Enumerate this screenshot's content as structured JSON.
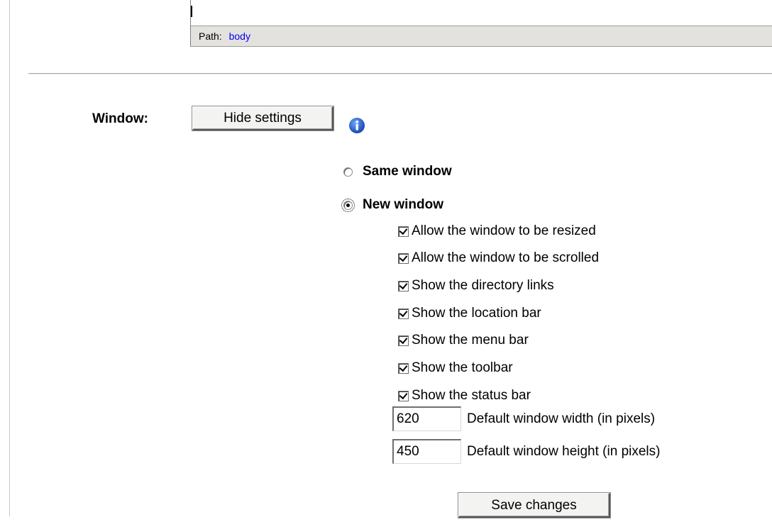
{
  "editor": {
    "path_label": "Path:",
    "path_value": "body"
  },
  "window_settings": {
    "label": "Window:",
    "hide_button": "Hide settings",
    "info_icon": "info-icon",
    "same_window": "Same window",
    "new_window": "New window",
    "selected": "New window",
    "options": [
      {
        "label": "Allow the window to be resized",
        "checked": true
      },
      {
        "label": "Allow the window to be scrolled",
        "checked": true
      },
      {
        "label": "Show the directory links",
        "checked": true
      },
      {
        "label": "Show the location bar",
        "checked": true
      },
      {
        "label": "Show the menu bar",
        "checked": true
      },
      {
        "label": "Show the toolbar",
        "checked": true
      },
      {
        "label": "Show the status bar",
        "checked": true
      }
    ],
    "width": {
      "value": "620",
      "label": "Default window width (in pixels)"
    },
    "height": {
      "value": "450",
      "label": "Default window height (in pixels)"
    },
    "save_button": "Save changes"
  },
  "colors": {
    "path_bar_bg": "#e4e2de",
    "link": "#0000ee",
    "info_icon": "#1f5fc6"
  }
}
